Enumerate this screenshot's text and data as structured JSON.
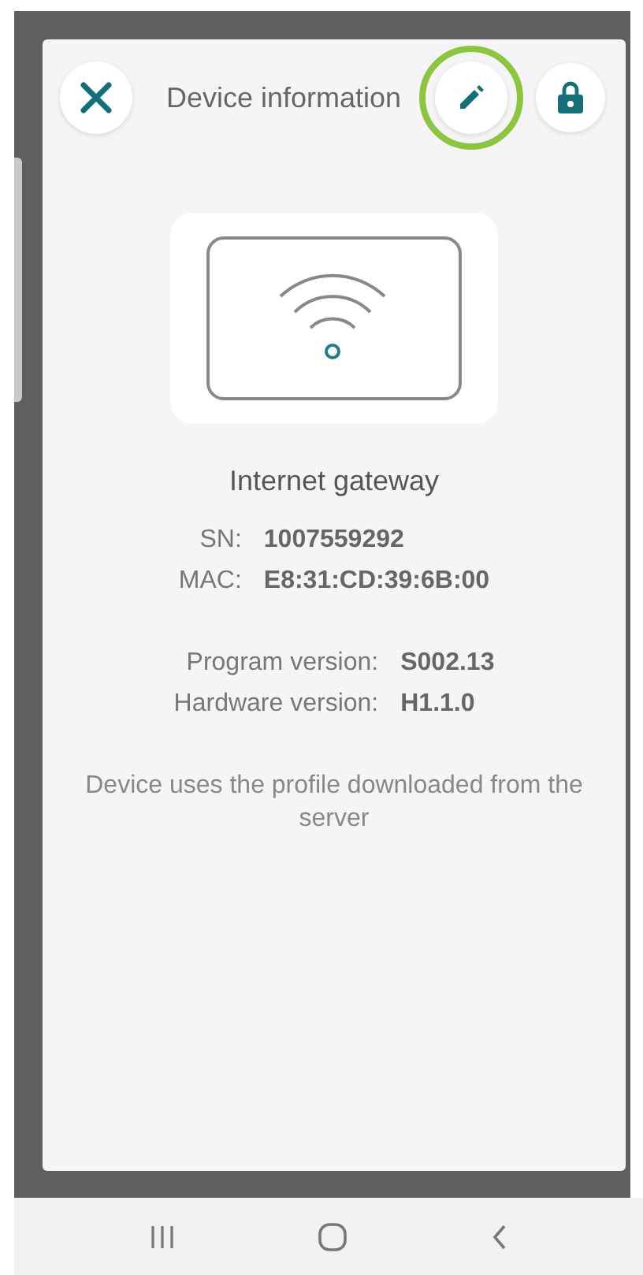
{
  "dialog": {
    "title": "Device information",
    "buttons": [
      {
        "kind": "close",
        "highlighted": false
      },
      {
        "kind": "edit",
        "highlighted": true
      },
      {
        "kind": "lock",
        "highlighted": false
      }
    ],
    "device_name": "Internet gateway",
    "ids": [
      {
        "label": "SN:",
        "value": "1007559292"
      },
      {
        "label": "MAC:",
        "value": "E8:31:CD:39:6B:00"
      }
    ],
    "versions": [
      {
        "label": "Program version:",
        "value": "S002.13"
      },
      {
        "label": "Hardware version:",
        "value": "H1.1.0"
      }
    ],
    "note": "Device uses the profile downloaded from the server"
  },
  "nav_bar": [
    {
      "kind": "recents"
    },
    {
      "kind": "home"
    },
    {
      "kind": "back"
    }
  ]
}
